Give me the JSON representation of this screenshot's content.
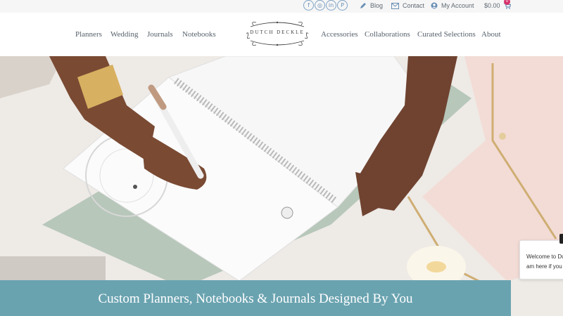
{
  "topbar": {
    "social": [
      {
        "icon": "facebook-icon",
        "glyph": "f"
      },
      {
        "icon": "instagram-icon",
        "glyph": "◎"
      },
      {
        "icon": "linkedin-icon",
        "glyph": "in"
      },
      {
        "icon": "pinterest-icon",
        "glyph": "P"
      }
    ],
    "blog": "Blog",
    "contact": "Contact",
    "account": "My Account",
    "cart_total": "$0.00",
    "cart_count": "0"
  },
  "logo": {
    "text": "DUTCH DECKLE"
  },
  "nav": {
    "planners": "Planners",
    "wedding": "Wedding",
    "journals": "Journals",
    "notebooks": "Notebooks",
    "accessories": "Accessories",
    "collaborations": "Collaborations",
    "curated": "Curated Selections",
    "about": "About"
  },
  "banner": {
    "headline": "Custom Planners, Notebooks & Journals Designed By You"
  },
  "chat": {
    "line1": "Welcome to Du",
    "line2": "am here if you"
  },
  "colors": {
    "banner": "#6aa3b0",
    "social": "#6a8fb5",
    "badge": "#d6336c"
  }
}
